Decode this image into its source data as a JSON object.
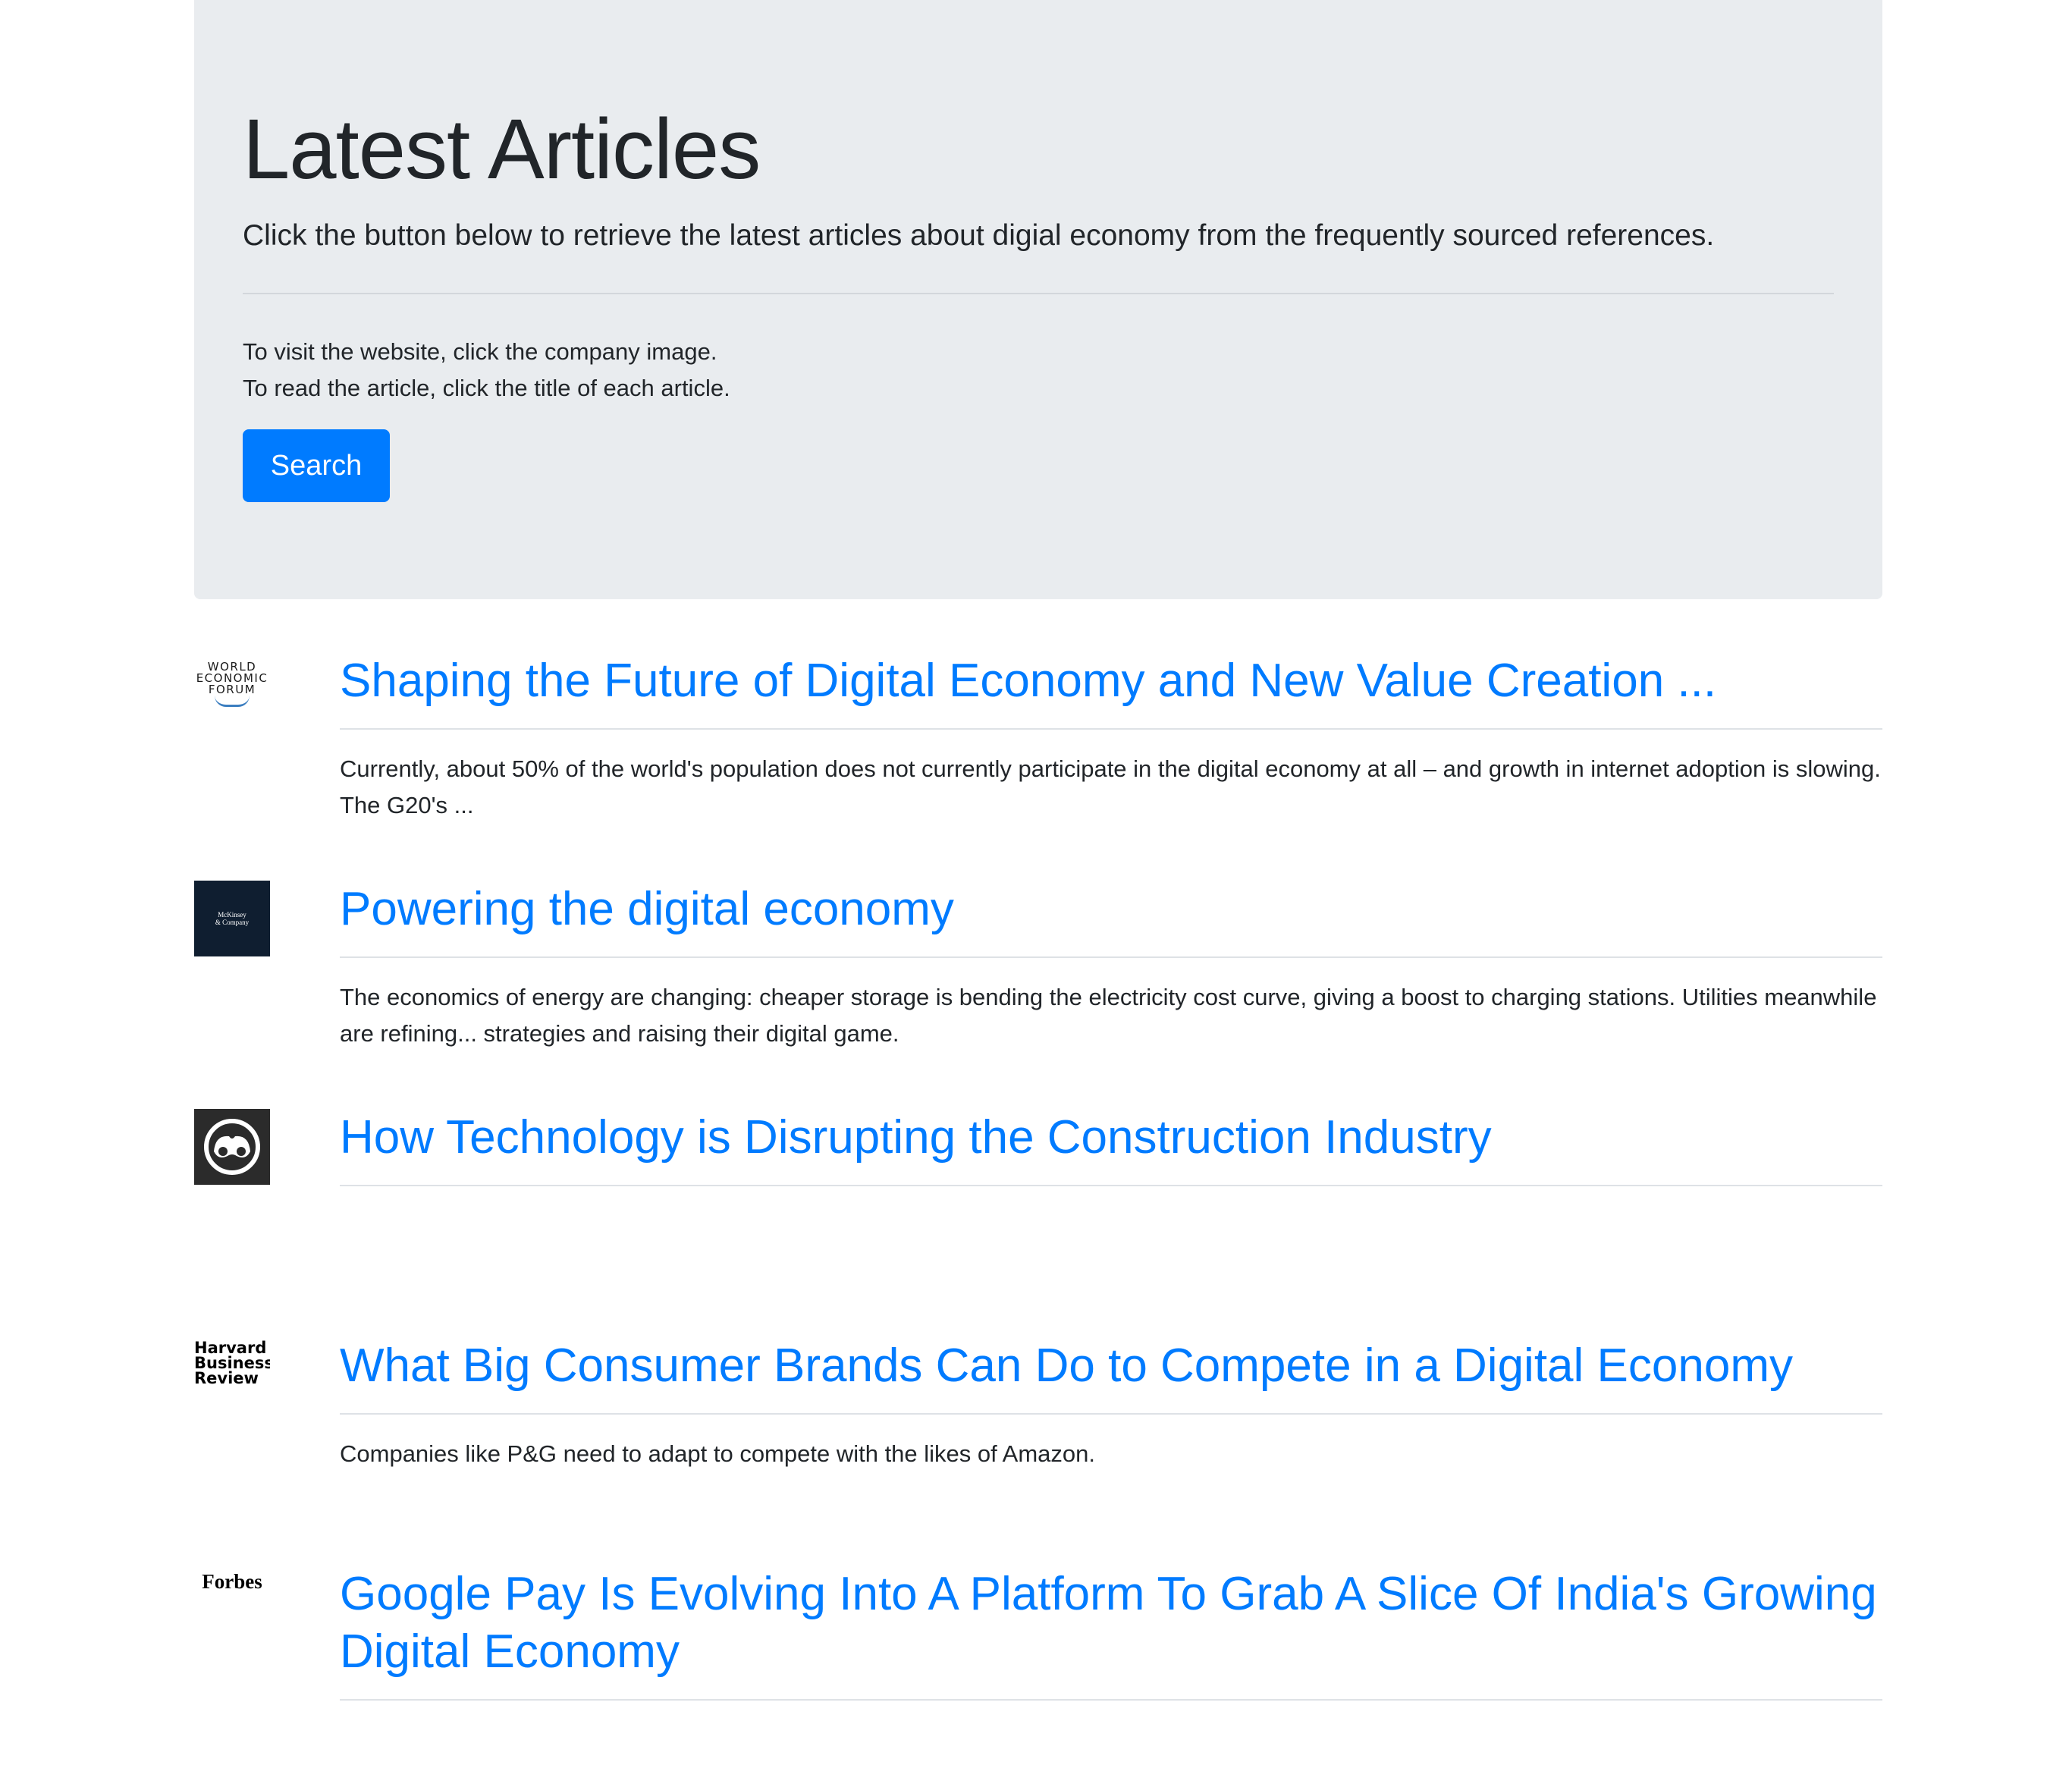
{
  "header": {
    "title": "Latest Articles",
    "lead": "Click the button below to retrieve the latest articles about digial economy from the frequently sourced references.",
    "instruction_1": "To visit the website, click the company image.",
    "instruction_2": "To read the article, click the title of each article.",
    "search_label": "Search",
    "accent_color": "#007bff"
  },
  "articles": [
    {
      "source": "World Economic Forum",
      "logo_text": [
        "WORLD",
        "ECONOMIC",
        "FORUM"
      ],
      "title": "Shaping the Future of Digital Economy and New Value Creation ...",
      "description": "Currently, about 50% of the world's population does not currently participate in the digital economy at all – and growth in internet adoption is slowing. The G20's  ..."
    },
    {
      "source": "McKinsey & Company",
      "logo_text": [
        "McKinsey",
        "& Company"
      ],
      "title": "Powering the digital economy",
      "description": "The economics of energy are changing: cheaper storage is bending the electricity cost curve, giving a boost to charging stations. Utilities meanwhile are refining... strategies and raising their digital game."
    },
    {
      "source": "logo-icon",
      "title": "How Technology is Disrupting the Construction Industry",
      "description": ""
    },
    {
      "source": "Harvard Business Review",
      "logo_text": [
        "Harvard",
        "Business",
        "Review"
      ],
      "title": "What Big Consumer Brands Can Do to Compete in a Digital Economy",
      "description": "Companies like P&G need to adapt to compete with the likes of Amazon."
    },
    {
      "source": "Forbes",
      "logo_text": [
        "Forbes"
      ],
      "title": "Google Pay Is Evolving Into A Platform To Grab A Slice Of India's Growing Digital Economy",
      "description": ""
    }
  ]
}
